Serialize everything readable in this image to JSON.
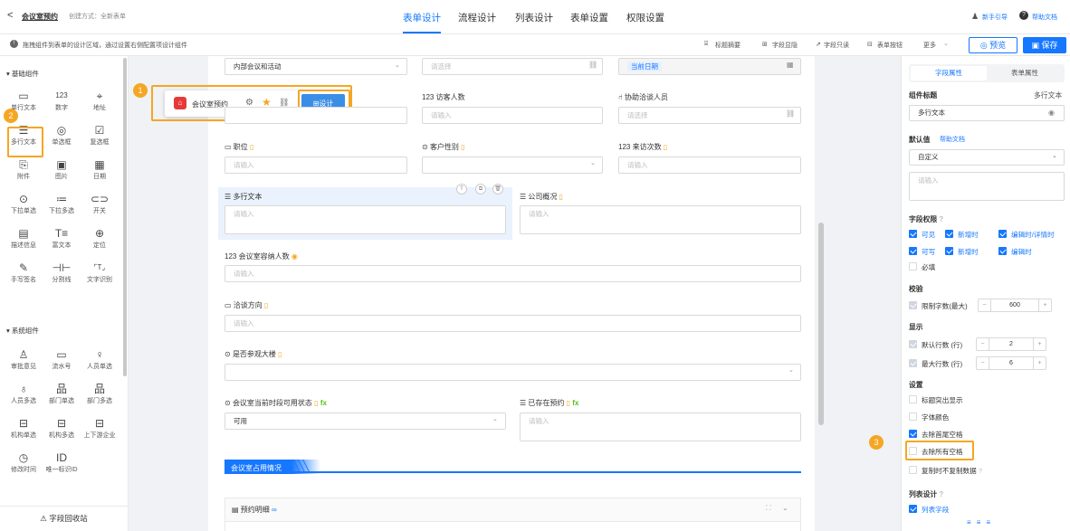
{
  "header": {
    "back": "<",
    "title": "会议室预约",
    "create_mode": "创建方式：全新表单",
    "tabs": [
      "表单设计",
      "流程设计",
      "列表设计",
      "表单设置",
      "权限设置"
    ],
    "active_tab": 0,
    "guide": "新手引导",
    "help": "帮助文档"
  },
  "subbar": {
    "tip": "拖拽组件到表单的设计区域，通过设置右侧配置项设计组件",
    "actions": [
      "标题摘要",
      "字段显隐",
      "字段只读",
      "表单按钮",
      "更多"
    ],
    "preview": "预览",
    "save": "保存"
  },
  "left": {
    "basic_title": "基础组件",
    "basic": [
      {
        "label": "单行文本",
        "icon": "single-line-icon",
        "glyph": "▭"
      },
      {
        "label": "数字",
        "icon": "number-icon",
        "glyph": "123"
      },
      {
        "label": "地址",
        "icon": "location-icon",
        "glyph": "⌖"
      },
      {
        "label": "多行文本",
        "icon": "multi-line-icon",
        "glyph": "☰"
      },
      {
        "label": "单选框",
        "icon": "radio-icon",
        "glyph": "◎"
      },
      {
        "label": "复选框",
        "icon": "checkbox-icon",
        "glyph": "☑"
      },
      {
        "label": "附件",
        "icon": "attachment-icon",
        "glyph": "⎘"
      },
      {
        "label": "图片",
        "icon": "image-icon",
        "glyph": "▣"
      },
      {
        "label": "日期",
        "icon": "calendar-icon",
        "glyph": "▦"
      },
      {
        "label": "下拉单选",
        "icon": "dropdown-single-icon",
        "glyph": "⊙"
      },
      {
        "label": "下拉多选",
        "icon": "dropdown-multi-icon",
        "glyph": "≔"
      },
      {
        "label": "开关",
        "icon": "switch-icon",
        "glyph": "⊂⊃"
      },
      {
        "label": "描述信息",
        "icon": "description-icon",
        "glyph": "▤"
      },
      {
        "label": "富文本",
        "icon": "rich-text-icon",
        "glyph": "T≡"
      },
      {
        "label": "定位",
        "icon": "locate-icon",
        "glyph": "⊕"
      },
      {
        "label": "手写签名",
        "icon": "signature-icon",
        "glyph": "✎"
      },
      {
        "label": "分割线",
        "icon": "divider-icon",
        "glyph": "⊣⊢"
      },
      {
        "label": "文字识别",
        "icon": "ocr-icon",
        "glyph": "⌜T⌟"
      }
    ],
    "system_title": "系统组件",
    "system": [
      {
        "label": "审批意见",
        "icon": "approval-icon",
        "glyph": "♙"
      },
      {
        "label": "流水号",
        "icon": "serial-icon",
        "glyph": "▭"
      },
      {
        "label": "人员单选",
        "icon": "user-icon",
        "glyph": "♀"
      },
      {
        "label": "人员多选",
        "icon": "users-icon",
        "glyph": "♁"
      },
      {
        "label": "部门单选",
        "icon": "dept-icon",
        "glyph": "品"
      },
      {
        "label": "部门多选",
        "icon": "depts-icon",
        "glyph": "品"
      },
      {
        "label": "机构单选",
        "icon": "org-icon",
        "glyph": "⊟"
      },
      {
        "label": "机构多选",
        "icon": "orgs-icon",
        "glyph": "⊟"
      },
      {
        "label": "上下游企业",
        "icon": "enterprise-icon",
        "glyph": "⊟"
      },
      {
        "label": "修改时间",
        "icon": "clock-icon",
        "glyph": "◷"
      },
      {
        "label": "唯一标识ID",
        "icon": "id-icon",
        "glyph": "ID"
      }
    ],
    "recycle": "字段回收站"
  },
  "canvas": {
    "top_select": "内部会议和活动",
    "top_select2_ph": "请选择",
    "top_date": "当前日期",
    "toolbar": {
      "form_name": "会议室预约",
      "design": "设计"
    },
    "visitors_label": "访客人数",
    "visitors_ph": "请输入",
    "assist_label": "协助洽谈人员",
    "assist_ph": "请选择",
    "position_label": "职位",
    "position_ph": "请输入",
    "gender_label": "客户性别",
    "visits_label": "来访次数",
    "visits_ph": "请输入",
    "multi_label": "多行文本",
    "multi_ph": "请输入",
    "company_label": "公司概况",
    "company_ph": "请输入",
    "capacity_label": "会议室容纳人数",
    "capacity_ph": "请输入",
    "direction_label": "洽谈方向",
    "direction_ph": "请输入",
    "visit_label": "是否参观大楼",
    "status_label": "会议室当前时段可用状态",
    "status_value": "可用",
    "booked_label": "已存在预约",
    "booked_ph": "请输入",
    "section_title": "会议室占用情况",
    "detail_title": "预约明细"
  },
  "right": {
    "tabs": [
      "字段属性",
      "表单属性"
    ],
    "comp_title_label": "组件标题",
    "comp_type": "多行文本",
    "comp_title_value": "多行文本",
    "default_label": "默认值",
    "help_doc": "帮助文档",
    "default_select": "自定义",
    "default_ph": "请输入",
    "perm_label": "字段权限",
    "perm_row1": [
      "可见",
      "新增时",
      "编辑时/详情时"
    ],
    "perm_row2": [
      "可写",
      "新增时",
      "编辑时"
    ],
    "required": "必填",
    "validate_label": "校验",
    "limit_label": "限制字数(最大)",
    "limit_value": "600",
    "display_label": "显示",
    "default_rows_label": "默认行数 (行)",
    "default_rows": "2",
    "max_rows_label": "最大行数 (行)",
    "max_rows": "6",
    "settings_label": "设置",
    "settings": [
      "标题突出显示",
      "字体颜色",
      "去除首尾空格",
      "去除所有空格",
      "复制时不复制数据"
    ],
    "list_design_label": "列表设计",
    "list_field": "列表字段"
  },
  "annotations": [
    "1",
    "2",
    "3"
  ],
  "colors": {
    "accent": "#1677ff",
    "highlight": "#f5a623"
  }
}
